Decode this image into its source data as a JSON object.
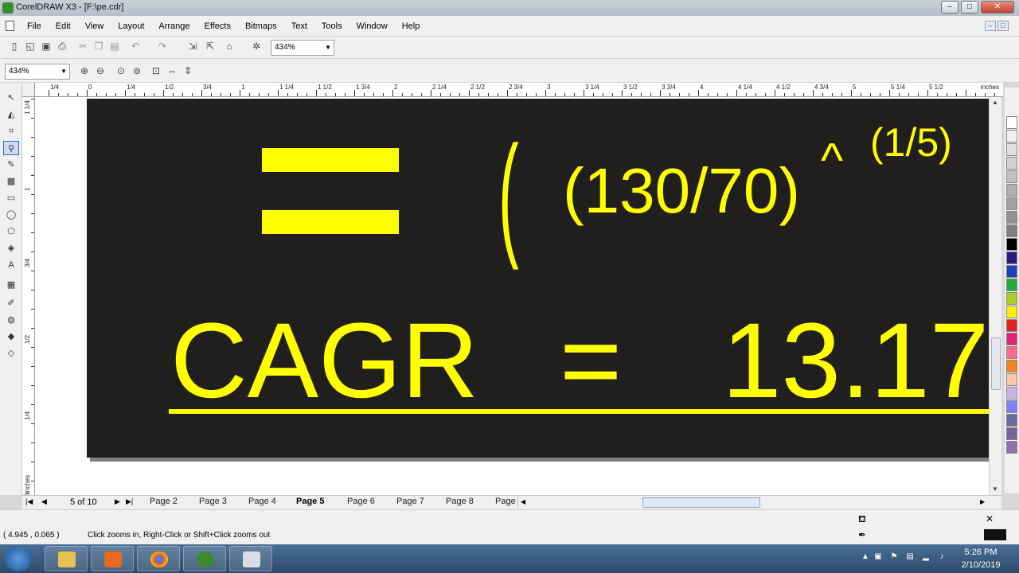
{
  "window": {
    "title": "CorelDRAW X3 - [F:\\pe.cdr]"
  },
  "menu": [
    "File",
    "Edit",
    "View",
    "Layout",
    "Arrange",
    "Effects",
    "Bitmaps",
    "Text",
    "Tools",
    "Window",
    "Help"
  ],
  "toolbar": {
    "zoom_standard": "434%",
    "zoom_property": "434%"
  },
  "ruler": {
    "unit": "inches",
    "labels": [
      "1/4",
      "0",
      "1/4",
      "1/2",
      "3/4",
      "1",
      "1 1/4",
      "1 1/2",
      "1 3/4",
      "2",
      "2 1/4",
      "2 1/2",
      "2 3/4",
      "3",
      "3 1/4",
      "3 1/2",
      "3 3/4",
      "4",
      "4 1/4",
      "4 1/2",
      "4 3/4",
      "5",
      "5 1/4",
      "5 1/2"
    ],
    "v_labels": [
      "1 1/4",
      "1",
      "3/4",
      "1/2",
      "1/4",
      "0"
    ]
  },
  "canvas": {
    "page_bg": "#211f1d",
    "text_color": "#ffff00",
    "paren": "(",
    "fraction": "(130/70)",
    "caret": "^",
    "exponent": "(1/5)",
    "result_label": "CAGR",
    "result_eq": "=",
    "result_value": "13.17"
  },
  "pages": {
    "count_label": "5 of 10",
    "tabs": [
      "Page 2",
      "Page 3",
      "Page 4",
      "Page 5",
      "Page 6",
      "Page 7",
      "Page 8",
      "Page"
    ],
    "current": "Page 5"
  },
  "status": {
    "coords": "( 4.945 , 0.065 )",
    "hint": "Click zooms in, Right-Click or Shift+Click zooms out"
  },
  "taskbar": {
    "time": "5:26 PM",
    "date": "2/10/2019"
  },
  "palette": [
    "#ffffff",
    "#f0f0f0",
    "#e0e0e0",
    "#d0d0d0",
    "#c0c0c0",
    "#b0b0b0",
    "#a0a0a0",
    "#909090",
    "#808080",
    "#000000",
    "#2b1a80",
    "#1e3fbf",
    "#1faa3f",
    "#a8cc28",
    "#ffee00",
    "#e62020",
    "#e6207a",
    "#ff6a8c",
    "#f58220",
    "#ffc8a0",
    "#c8b4e6",
    "#8080ff",
    "#6a6aa0",
    "#7a60a0",
    "#9070b0"
  ]
}
